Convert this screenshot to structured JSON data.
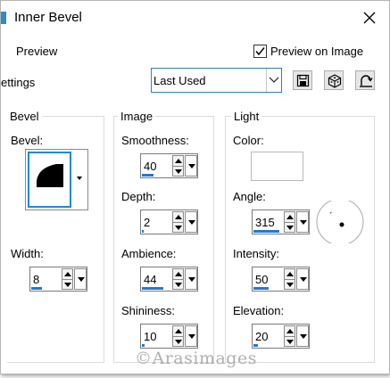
{
  "window": {
    "title": "Inner Bevel",
    "close_label": "close",
    "accent_color": "#1f7ad1"
  },
  "preview": {
    "label": "Preview",
    "preview_on_image_label": "Preview on Image",
    "preview_on_image_checked": true
  },
  "settings": {
    "label": "ettings",
    "preset_value": "Last Used",
    "icons": [
      "save-icon",
      "random-icon",
      "reset-icon"
    ]
  },
  "bevel_group": {
    "title": "Bevel",
    "bevel_label": "Bevel:",
    "width_label": "Width:",
    "width_value": "8",
    "width_fraction": 0.35
  },
  "image_group": {
    "title": "Image",
    "smoothness_label": "Smoothness:",
    "smoothness_value": "40",
    "smoothness_fraction": 0.4,
    "depth_label": "Depth:",
    "depth_value": "2",
    "depth_fraction": 0.0,
    "ambience_label": "Ambience:",
    "ambience_value": "44",
    "ambience_fraction": 0.72,
    "shininess_label": "Shininess:",
    "shininess_value": "10",
    "shininess_fraction": 0.1
  },
  "light_group": {
    "title": "Light",
    "color_label": "Color:",
    "color_value": "#ffffff",
    "angle_label": "Angle:",
    "angle_value": "315",
    "angle_fraction": 0.87,
    "intensity_label": "Intensity:",
    "intensity_value": "50",
    "intensity_fraction": 0.5,
    "elevation_label": "Elevation:",
    "elevation_value": "20",
    "elevation_fraction": 0.15
  },
  "watermark": "©Arasimages"
}
